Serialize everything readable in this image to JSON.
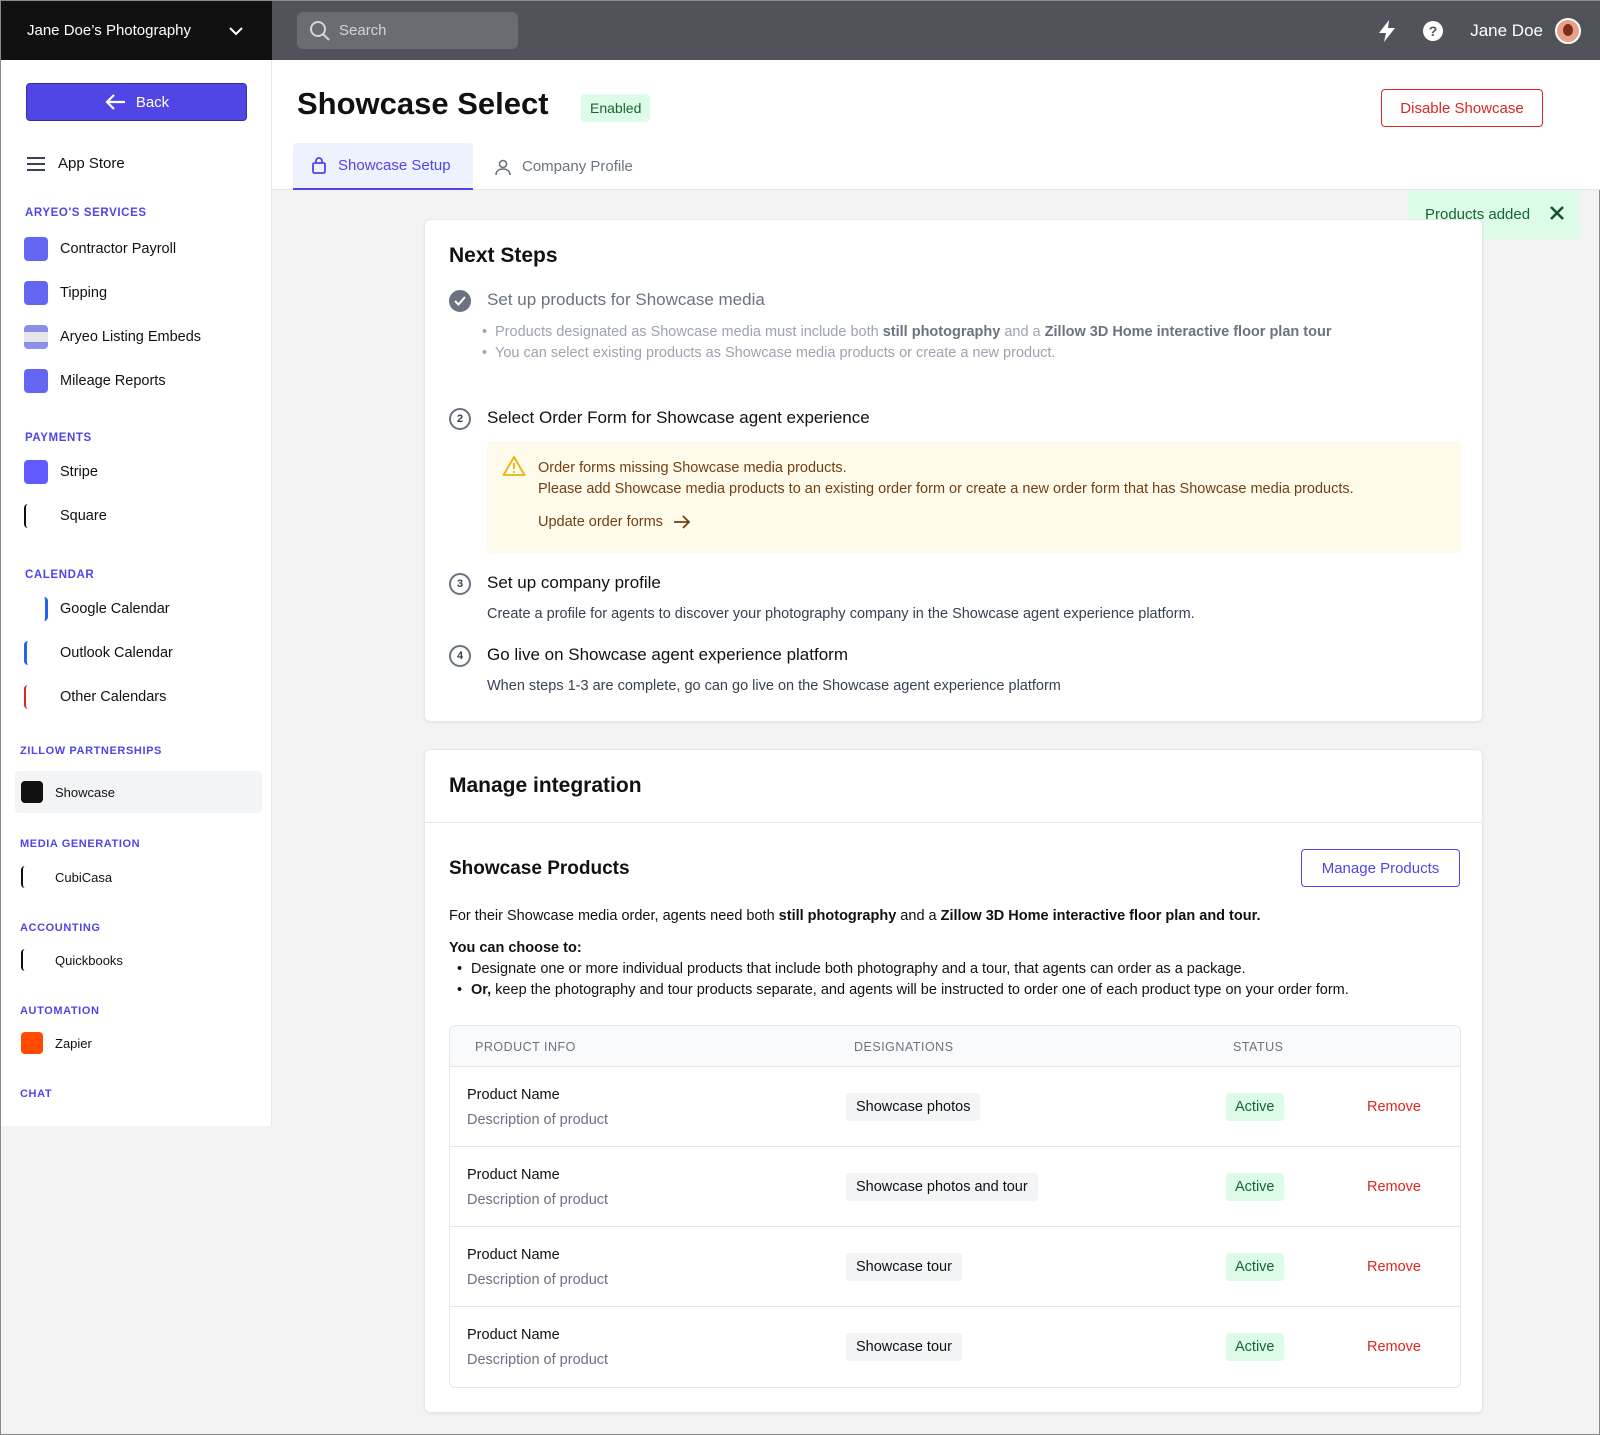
{
  "topbar": {
    "brand": "Jane Doe’s Photography",
    "search_placeholder": "Search",
    "user_name": "Jane Doe"
  },
  "sidebar": {
    "back_label": "Back",
    "app_store_label": "App Store",
    "sections": {
      "services": "ARYEO'S SERVICES",
      "payments": "PAYMENTS",
      "calendar": "CALENDAR",
      "zillow": "ZILLOW PARTNERSHIPS",
      "media": "MEDIA GENERATION",
      "accounting": "ACCOUNTING",
      "automation": "AUTOMATION",
      "chat": "CHAT"
    },
    "items": {
      "contractor_payroll": "Contractor Payroll",
      "tipping": "Tipping",
      "listing_embeds": "Aryeo Listing Embeds",
      "mileage_reports": "Mileage Reports",
      "stripe": "Stripe",
      "square": "Square",
      "google_calendar": "Google Calendar",
      "outlook_calendar": "Outlook Calendar",
      "other_calendars": "Other Calendars",
      "showcase": "Showcase",
      "cubicasa": "CubiCasa",
      "quickbooks": "Quickbooks",
      "zapier": "Zapier"
    }
  },
  "header": {
    "title": "Showcase Select",
    "status_badge": "Enabled",
    "disable_label": "Disable Showcase",
    "tabs": [
      "Showcase Setup",
      "Company Profile"
    ]
  },
  "toast": {
    "message": "Products added"
  },
  "next_steps": {
    "title": "Next Steps",
    "step1": {
      "title": "Set up products for Showcase media",
      "bullet1_a": "Products designated as Showcase media must include both ",
      "bullet1_b": "still photography",
      "bullet1_c": " and a ",
      "bullet1_d": "Zillow 3D Home interactive floor plan tour",
      "bullet2": "You can select existing products as Showcase media products or create a new product."
    },
    "step2": {
      "num": "2",
      "title": "Select Order Form for Showcase agent experience",
      "warning_title": "Order forms missing Showcase media products.",
      "warning_body": "Please add Showcase media products to an existing order form or create a new order form that has Showcase media products.",
      "warning_link": "Update order forms"
    },
    "step3": {
      "num": "3",
      "title": "Set up company profile",
      "desc": "Create a profile for agents to discover your photography company in the Showcase agent experience platform."
    },
    "step4": {
      "num": "4",
      "title": "Go live on Showcase agent experience platform",
      "desc": "When steps 1-3 are complete, go can go live on the Showcase agent experience platform"
    }
  },
  "manage": {
    "title": "Manage integration",
    "products_title": "Showcase Products",
    "manage_btn": "Manage Products",
    "intro_a": "For their Showcase media order, agents need both ",
    "intro_b": "still photography",
    "intro_c": " and a ",
    "intro_d": "Zillow 3D Home interactive floor plan and tour.",
    "choose": "You can choose to:",
    "opt1": "Designate one or more individual products that include both photography and a tour, that agents can order as a package.",
    "opt2_b": "Or,",
    "opt2": " keep the photography and tour products separate, and agents will be instructed to order one of each product type on your order form.",
    "table": {
      "headers": [
        "PRODUCT INFO",
        "DESIGNATIONS",
        "STATUS"
      ],
      "rows": [
        {
          "name": "Product Name",
          "desc": "Description of product",
          "designation": "Showcase photos",
          "status": "Active",
          "action": "Remove"
        },
        {
          "name": "Product Name",
          "desc": "Description of product",
          "designation": "Showcase photos and tour",
          "status": "Active",
          "action": "Remove"
        },
        {
          "name": "Product Name",
          "desc": "Description of product",
          "designation": "Showcase tour",
          "status": "Active",
          "action": "Remove"
        },
        {
          "name": "Product Name",
          "desc": "Description of product",
          "designation": "Showcase tour",
          "status": "Active",
          "action": "Remove"
        }
      ]
    }
  },
  "colors": {
    "accent": "#4f46e5",
    "danger": "#dc2626",
    "success_bg": "#dcfce7",
    "success_text": "#166534",
    "warning_bg": "#fffbeb"
  },
  "icons": [
    "chevron-down-icon",
    "search-icon",
    "bolt-icon",
    "help-icon",
    "arrow-left-icon",
    "menu-icon",
    "bag-icon",
    "user-icon",
    "close-icon",
    "check-icon",
    "warning-icon",
    "arrow-right-icon"
  ]
}
